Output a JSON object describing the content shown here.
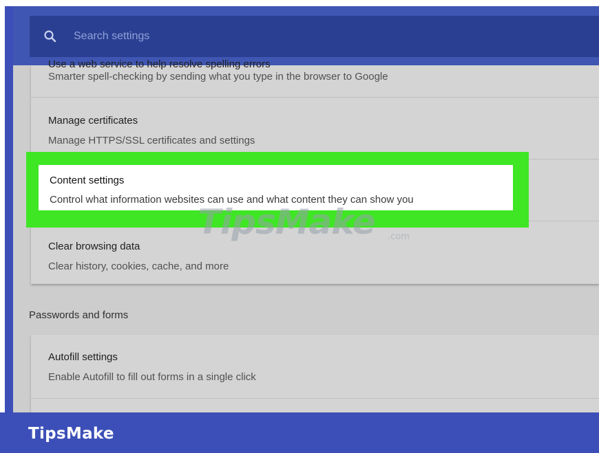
{
  "search": {
    "placeholder": "Search settings",
    "icon": "search-icon"
  },
  "privacy_section": {
    "items": [
      {
        "title": "Use a web service to help resolve spelling errors",
        "description": "Smarter spell-checking by sending what you type in the browser to Google"
      },
      {
        "title": "Manage certificates",
        "description": "Manage HTTPS/SSL certificates and settings"
      },
      {
        "title": "Content settings",
        "description": "Control what information websites can use and what content they can show you",
        "highlighted": true
      },
      {
        "title": "Clear browsing data",
        "description": "Clear history, cookies, cache, and more"
      }
    ]
  },
  "passwords_section": {
    "heading": "Passwords and forms",
    "items": [
      {
        "title": "Autofill settings",
        "description": "Enable Autofill to fill out forms in a single click"
      }
    ]
  },
  "watermark": {
    "text": "TipsMake",
    "suffix": ".com"
  },
  "brand": {
    "name": "TipsMake"
  },
  "colors": {
    "highlight": "#3ee624",
    "brand_bar": "#3c4fb8",
    "search_bar": "#2b3f92"
  }
}
